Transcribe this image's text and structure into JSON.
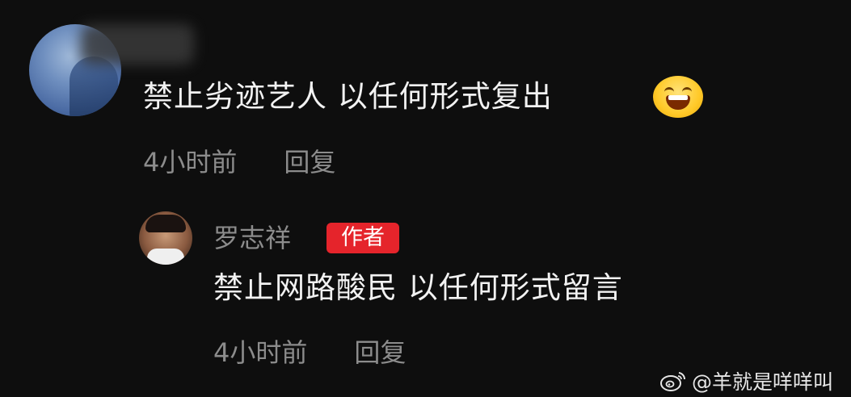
{
  "comment": {
    "text": "禁止劣迹艺人 以任何形式复出",
    "emoji": "laughing-face-emoji",
    "time": "4小时前",
    "reply_label": "回复"
  },
  "reply": {
    "author": "罗志祥",
    "badge": "作者",
    "text": "禁止网路酸民 以任何形式留言",
    "time": "4小时前",
    "reply_label": "回复"
  },
  "watermark": {
    "logo": "weibo-logo",
    "text": "@羊就是咩咩叫"
  },
  "colors": {
    "background": "#0e0e0e",
    "primary_text": "#f2f2f2",
    "meta_text": "#8c8c8c",
    "badge_bg": "#e5242b"
  }
}
